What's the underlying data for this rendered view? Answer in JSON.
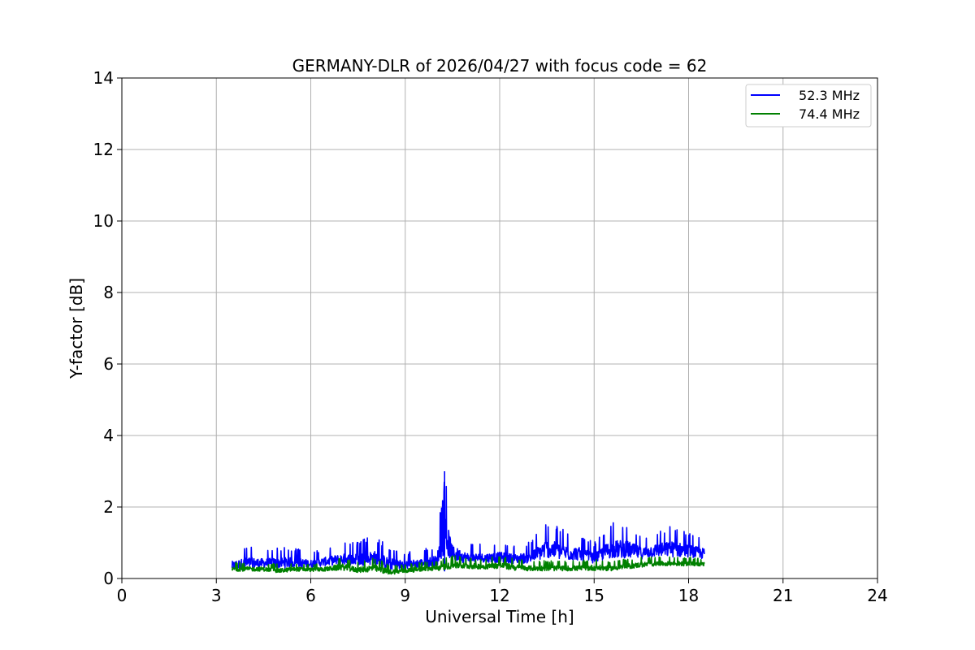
{
  "chart_data": {
    "type": "line",
    "title": "GERMANY-DLR of 2026/04/27 with focus code = 62",
    "xlabel": "Universal Time [h]",
    "ylabel": "Y-factor [dB]",
    "xlim": [
      0,
      24
    ],
    "ylim": [
      0,
      14
    ],
    "xticks": [
      "0",
      "3",
      "6",
      "9",
      "12",
      "15",
      "18",
      "21",
      "24"
    ],
    "yticks": [
      "0",
      "2",
      "4",
      "6",
      "8",
      "10",
      "12",
      "14"
    ],
    "grid": true,
    "legend_position": "top-right",
    "series": [
      {
        "name": "52.3 MHz",
        "color": "#0000ff",
        "x": [
          3.5,
          4.0,
          4.5,
          5.0,
          5.5,
          6.0,
          6.5,
          7.0,
          7.5,
          8.0,
          8.5,
          9.0,
          9.5,
          10.0,
          10.25,
          10.5,
          11.0,
          11.5,
          12.0,
          12.5,
          13.0,
          13.5,
          14.0,
          14.5,
          15.0,
          15.5,
          16.0,
          16.5,
          17.0,
          17.5,
          18.0,
          18.5
        ],
        "lower": [
          0.1,
          0.1,
          0.2,
          0.15,
          0.2,
          0.2,
          0.25,
          0.25,
          0.2,
          0.2,
          0.1,
          0.15,
          0.2,
          0.2,
          0.2,
          0.3,
          0.3,
          0.35,
          0.3,
          0.3,
          0.3,
          0.35,
          0.3,
          0.35,
          0.3,
          0.35,
          0.35,
          0.4,
          0.45,
          0.4,
          0.45,
          0.4
        ],
        "upper": [
          0.75,
          0.95,
          0.8,
          0.9,
          0.85,
          0.75,
          0.85,
          1.0,
          1.05,
          1.2,
          0.9,
          0.75,
          0.8,
          0.95,
          3.0,
          1.35,
          1.0,
          0.95,
          1.05,
          0.95,
          1.05,
          1.65,
          1.4,
          1.25,
          1.0,
          1.55,
          1.6,
          1.2,
          1.35,
          1.5,
          1.3,
          1.15
        ]
      },
      {
        "name": "74.4 MHz",
        "color": "#008000",
        "x": [
          3.5,
          4.0,
          4.5,
          5.0,
          5.5,
          6.0,
          6.5,
          7.0,
          7.5,
          8.0,
          8.5,
          9.0,
          9.5,
          10.0,
          10.5,
          11.0,
          11.5,
          12.0,
          12.5,
          13.0,
          13.5,
          14.0,
          14.5,
          15.0,
          15.5,
          16.0,
          16.5,
          17.0,
          17.5,
          18.0,
          18.5
        ],
        "lower": [
          0.15,
          0.15,
          0.15,
          0.1,
          0.15,
          0.15,
          0.15,
          0.15,
          0.1,
          0.1,
          0.05,
          0.1,
          0.15,
          0.15,
          0.2,
          0.2,
          0.2,
          0.2,
          0.15,
          0.15,
          0.15,
          0.15,
          0.15,
          0.15,
          0.15,
          0.2,
          0.25,
          0.3,
          0.3,
          0.3,
          0.3
        ],
        "upper": [
          0.45,
          0.45,
          0.45,
          0.4,
          0.45,
          0.4,
          0.45,
          0.6,
          0.45,
          0.6,
          0.4,
          0.4,
          0.45,
          0.5,
          0.65,
          0.6,
          0.55,
          0.65,
          0.55,
          0.5,
          0.5,
          0.5,
          0.5,
          0.55,
          0.5,
          0.55,
          0.6,
          0.6,
          0.6,
          0.6,
          0.55
        ]
      }
    ]
  }
}
